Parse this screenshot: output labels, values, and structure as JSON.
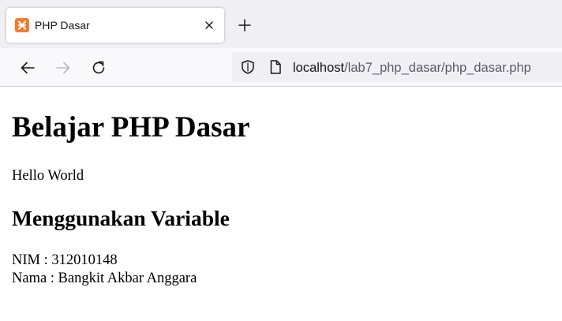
{
  "browser": {
    "tab": {
      "title": "PHP Dasar",
      "favicon": "xampp-icon",
      "favicon_color": "#f57a2e"
    },
    "new_tab_icon": "plus-icon",
    "toolbar": {
      "back_icon": "arrow-left-icon",
      "forward_icon": "arrow-right-icon",
      "reload_icon": "reload-icon"
    },
    "urlbar": {
      "host": "localhost",
      "path": "/lab7_php_dasar/php_dasar.php",
      "security_icon": "shield-icon",
      "page_icon": "page-icon"
    }
  },
  "page": {
    "heading": "Belajar PHP Dasar",
    "hello": "Hello World",
    "subheading": "Menggunakan Variable",
    "nim_line": "NIM : 312010148",
    "nama_line": "Nama : Bangkit Akbar Anggara"
  }
}
